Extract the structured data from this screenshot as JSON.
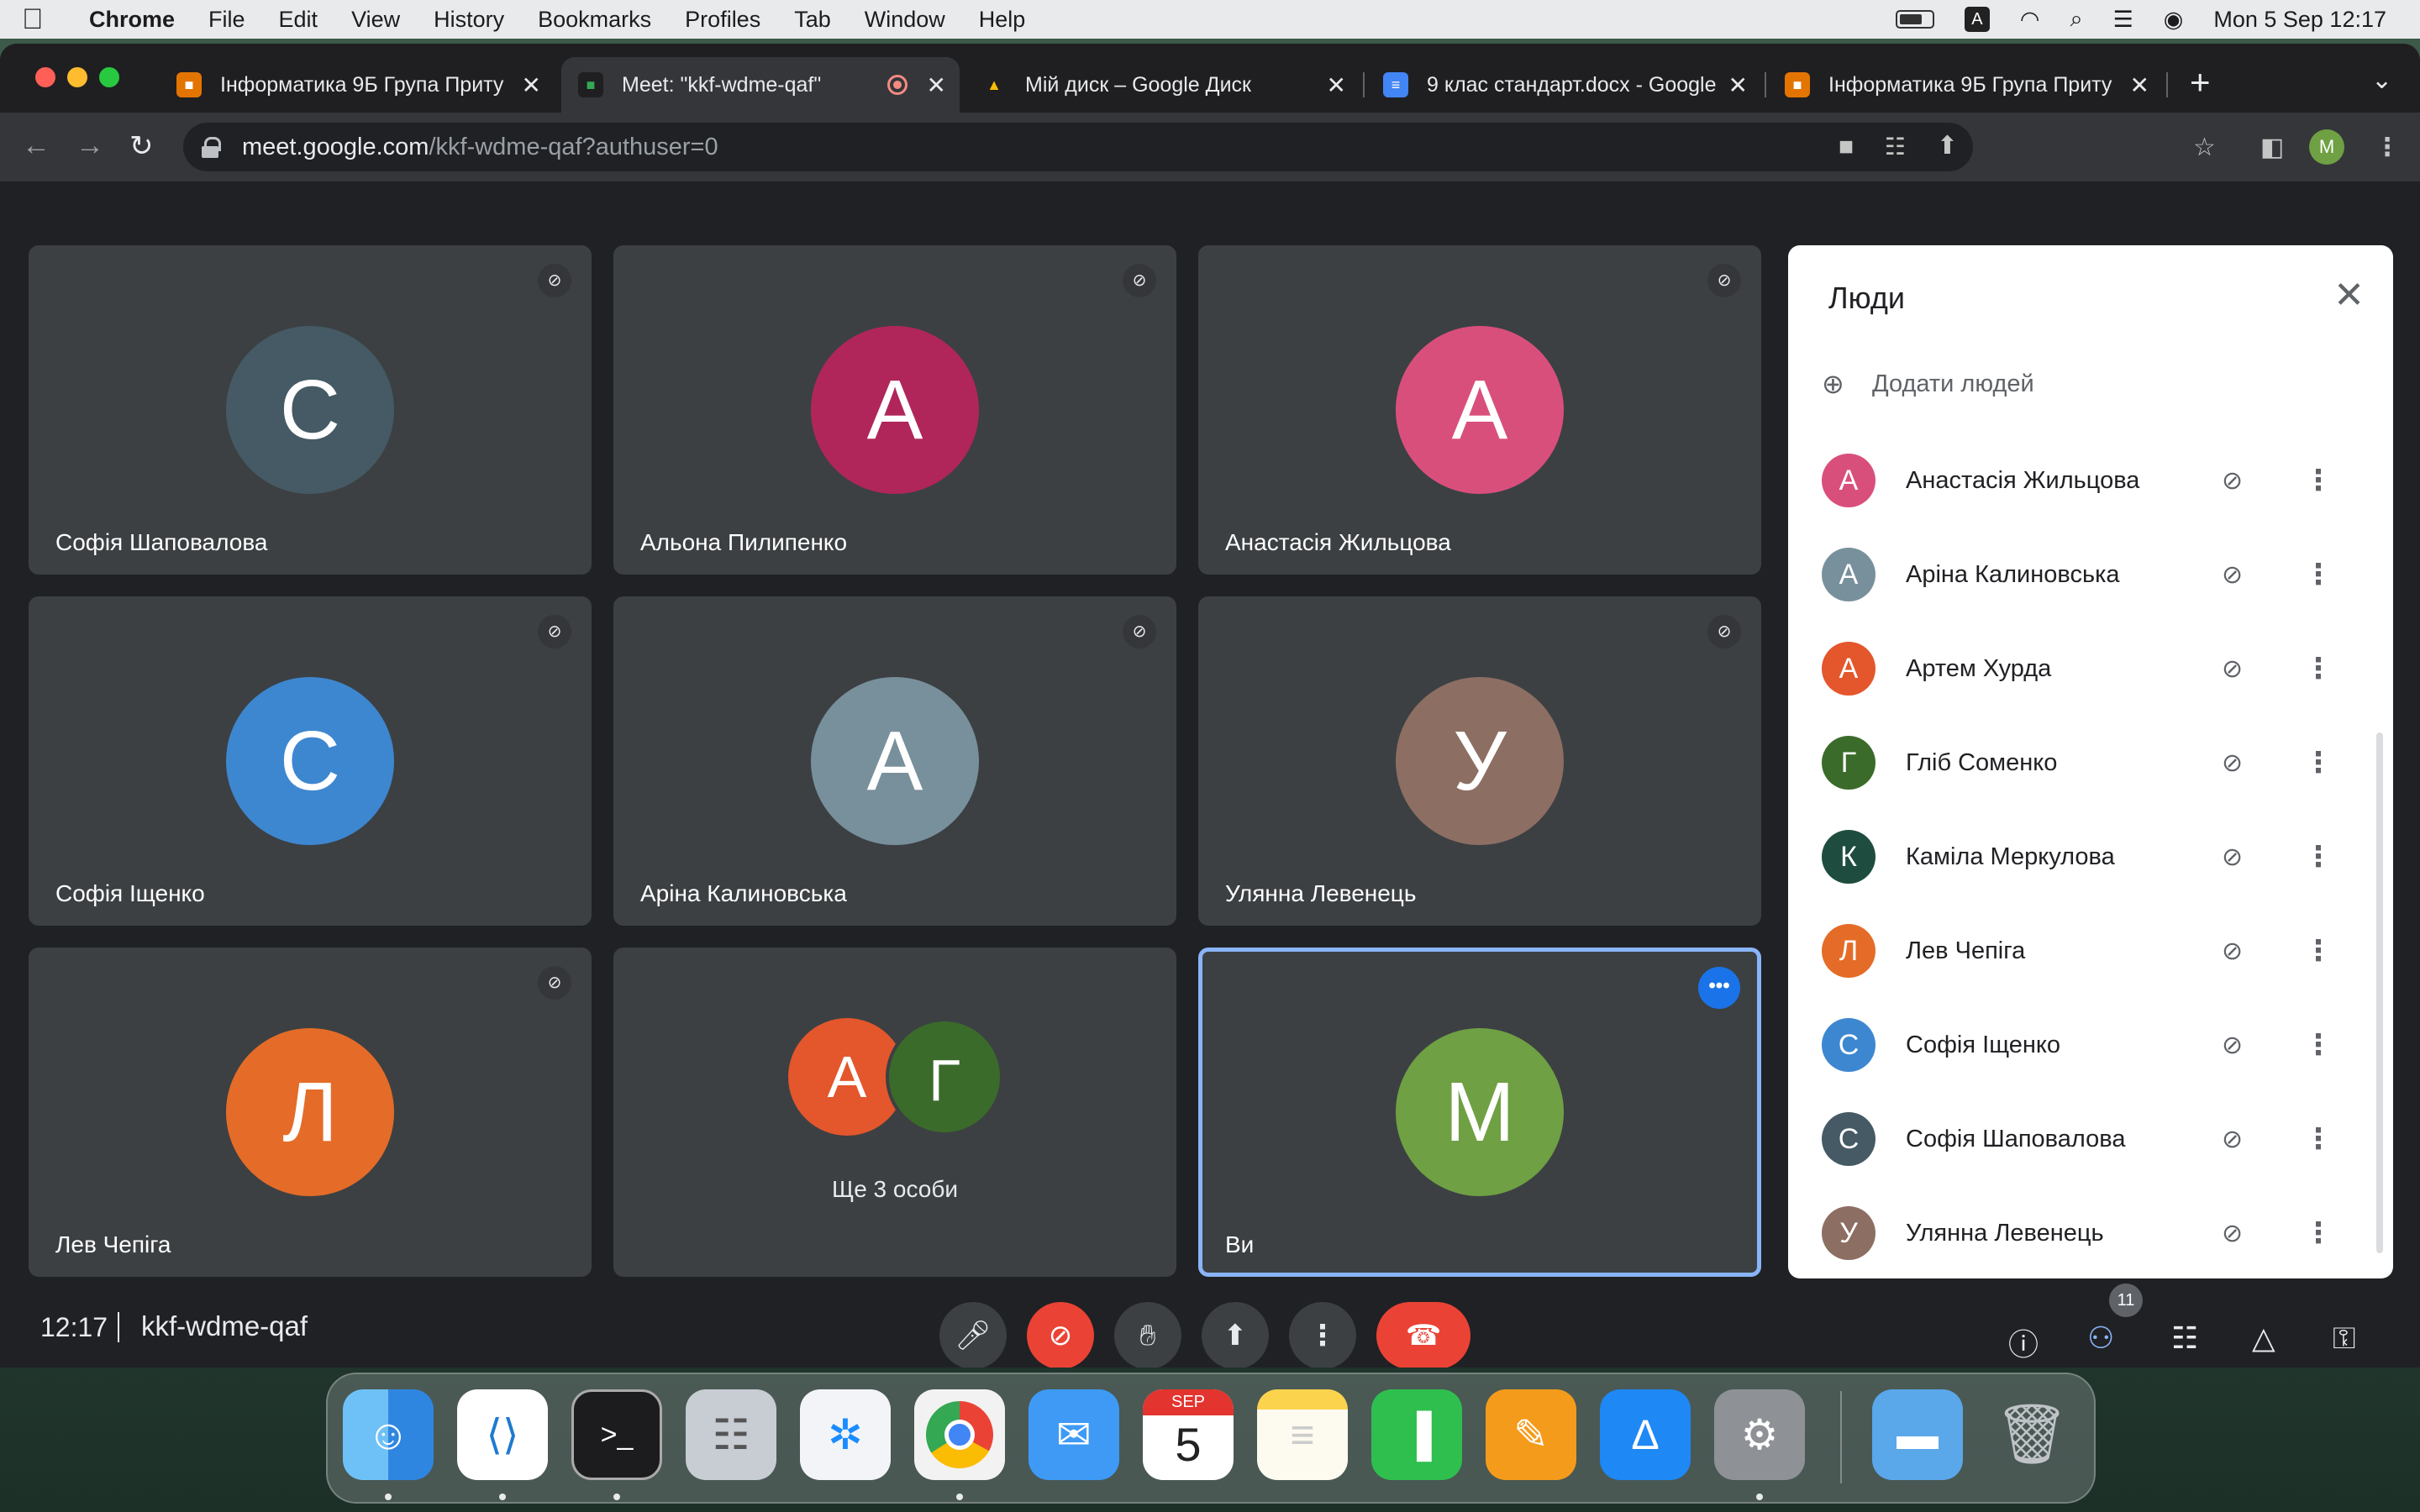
{
  "menubar": {
    "app": "Chrome",
    "items": [
      "File",
      "Edit",
      "View",
      "History",
      "Bookmarks",
      "Profiles",
      "Tab",
      "Window",
      "Help"
    ],
    "input_source": "A",
    "clock": "Mon 5 Sep  12:17"
  },
  "tabs": [
    {
      "title": "Інформатика 9Б Група Приту",
      "favicon": "classroom-icon"
    },
    {
      "title": "Meet: \"kkf-wdme-qaf\"",
      "favicon": "meet-icon",
      "active": true
    },
    {
      "title": "Мій диск – Google Диск",
      "favicon": "drive-icon"
    },
    {
      "title": "9 клас стандарт.docx - Google",
      "favicon": "docs-icon"
    },
    {
      "title": "Інформатика 9Б Група Приту",
      "favicon": "classroom-icon"
    }
  ],
  "toolbar": {
    "url_host": "meet.google.com",
    "url_path": "/kkf-wdme-qaf?authuser=0",
    "profile_initial": "M"
  },
  "tiles": [
    {
      "initial": "С",
      "name": "Софія Шаповалова",
      "color": "#455a64"
    },
    {
      "initial": "А",
      "name": "Альона Пилипенко",
      "color": "#b0265a"
    },
    {
      "initial": "А",
      "name": "Анастасія Жильцова",
      "color": "#d94f7c"
    },
    {
      "initial": "С",
      "name": "Софія Іщенко",
      "color": "#3d87d0"
    },
    {
      "initial": "А",
      "name": "Аріна Калиновська",
      "color": "#78909c"
    },
    {
      "initial": "У",
      "name": "Улянна Левенець",
      "color": "#8d6e63"
    },
    {
      "initial": "Л",
      "name": "Лев Чепіга",
      "color": "#e46c28"
    },
    {
      "group": [
        "А",
        "Г"
      ],
      "group_colors": [
        "#e4562c",
        "#3b6b2a"
      ],
      "label": "Ще 3 особи"
    },
    {
      "initial": "M",
      "name": "Ви",
      "color": "#6fa043",
      "self": true
    }
  ],
  "people_panel": {
    "title": "Люди",
    "add_label": "Додати людей",
    "participants": [
      {
        "initial": "А",
        "name": "Анастасія Жильцова",
        "color": "#d94f7c"
      },
      {
        "initial": "А",
        "name": "Аріна Калиновська",
        "color": "#78909c"
      },
      {
        "initial": "А",
        "name": "Артем Хурда",
        "color": "#e4562c"
      },
      {
        "initial": "Г",
        "name": "Гліб Соменко",
        "color": "#3b6b2a"
      },
      {
        "initial": "К",
        "name": "Каміла Меркулова",
        "color": "#1e4d3f"
      },
      {
        "initial": "Л",
        "name": "Лев Чепіга",
        "color": "#e46c28"
      },
      {
        "initial": "С",
        "name": "Софія Іщенко",
        "color": "#3d87d0"
      },
      {
        "initial": "С",
        "name": "Софія Шаповалова",
        "color": "#455a64"
      },
      {
        "initial": "У",
        "name": "Улянна Левенець",
        "color": "#8d6e63"
      }
    ]
  },
  "bottombar": {
    "time": "12:17",
    "meeting_code": "kkf-wdme-qaf",
    "participant_count": "11"
  },
  "dock": {
    "calendar_month": "SEP",
    "calendar_day": "5"
  }
}
